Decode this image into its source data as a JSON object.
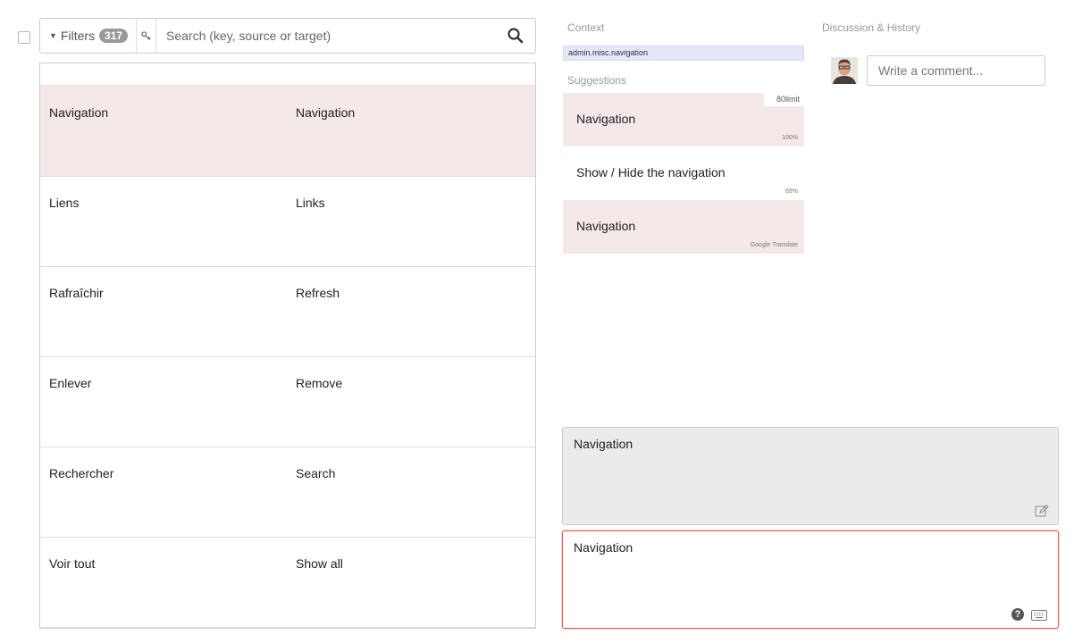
{
  "search": {
    "filters_label": "Filters",
    "count": "317",
    "placeholder": "Search (key, source or target)"
  },
  "rows": [
    {
      "source": "Navigation",
      "target": "Navigation"
    },
    {
      "source": "Liens",
      "target": "Links"
    },
    {
      "source": "Rafraîchir",
      "target": "Refresh"
    },
    {
      "source": "Enlever",
      "target": "Remove"
    },
    {
      "source": "Rechercher",
      "target": "Search"
    },
    {
      "source": "Voir tout",
      "target": "Show all"
    }
  ],
  "context": {
    "label": "Context",
    "key": "admin.misc.navigation"
  },
  "suggestions": {
    "label": "Suggestions",
    "limit": "80limit",
    "items": [
      {
        "text": "Navigation",
        "meta": "100%"
      },
      {
        "text": "Show / Hide the navigation",
        "meta": "69%"
      },
      {
        "text": "Navigation",
        "meta": "Google Translate"
      }
    ]
  },
  "discussion": {
    "label": "Discussion & History",
    "comment_placeholder": "Write a comment..."
  },
  "editor": {
    "source_text": "Navigation",
    "target_text": "Navigation",
    "help_glyph": "?"
  },
  "colors": {
    "selected_row": "#f5e8e9",
    "context_key_bg": "#e6e6fb",
    "target_border": "#e05a5a"
  }
}
